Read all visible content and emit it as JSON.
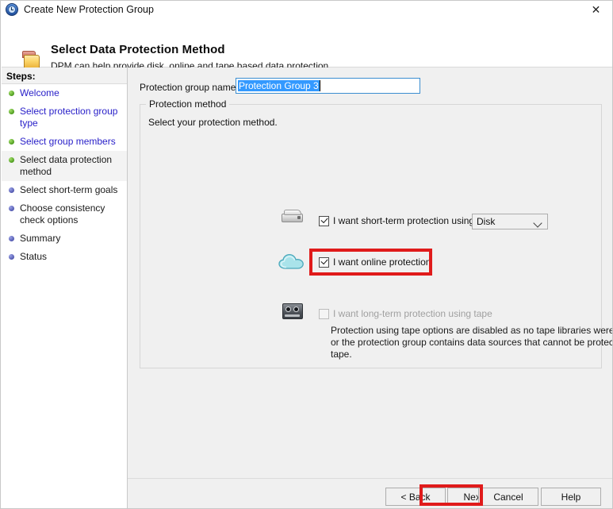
{
  "window": {
    "title": "Create New Protection Group",
    "icon": "clock-history-icon",
    "close_label": "✕"
  },
  "header": {
    "icon": "folder-icon",
    "title": "Select Data Protection Method",
    "subtitle": "DPM can help provide disk, online and tape based data protection."
  },
  "sidebar": {
    "heading": "Steps:",
    "items": [
      {
        "label": "Welcome",
        "state": "done",
        "current": false
      },
      {
        "label": "Select protection group type",
        "state": "done",
        "current": false
      },
      {
        "label": "Select group members",
        "state": "done",
        "current": false
      },
      {
        "label": "Select data protection method",
        "state": "done",
        "current": true
      },
      {
        "label": "Select short-term goals",
        "state": "todo",
        "current": false
      },
      {
        "label": "Choose consistency check options",
        "state": "todo",
        "current": false
      },
      {
        "label": "Summary",
        "state": "todo",
        "current": false
      },
      {
        "label": "Status",
        "state": "todo",
        "current": false
      }
    ]
  },
  "main": {
    "group_name_label": "Protection group name:",
    "group_name_value": "Protection Group 3",
    "group_name_selected": true,
    "groupbox_title": "Protection method",
    "groupbox_intro": "Select your protection method.",
    "short_term": {
      "icon": "disk-icon",
      "label": "I want short-term protection using:",
      "checked": true,
      "dropdown_value": "Disk"
    },
    "online": {
      "icon": "cloud-icon",
      "label": "I want online protection",
      "checked": true,
      "highlighted": true
    },
    "tape": {
      "icon": "tape-cartridge-icon",
      "label": "I want long-term protection using tape",
      "checked": false,
      "disabled": true,
      "note": "Protection using tape options are disabled as no tape libraries were detected or the protection group contains data sources that cannot be protected on tape."
    }
  },
  "buttons": {
    "back": "< Back",
    "next": "Next >",
    "cancel": "Cancel",
    "help": "Help",
    "next_highlighted": true
  },
  "colors": {
    "highlight_red": "#e01b1b",
    "selection_blue": "#3399ff",
    "link_blue": "#2a21c9",
    "window_bg": "#f0f0f0"
  }
}
